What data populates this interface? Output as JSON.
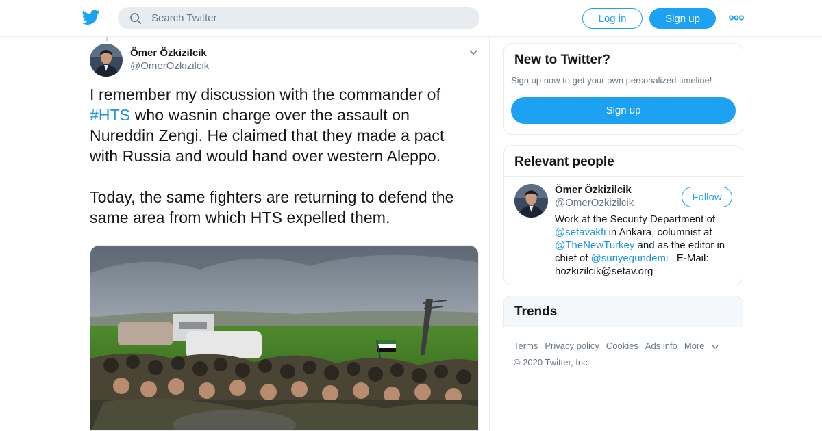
{
  "header": {
    "search_placeholder": "Search Twitter",
    "login_label": "Log in",
    "signup_label": "Sign up",
    "logo_icon": "twitter-bird-icon",
    "brand_color": "#1da1f2"
  },
  "tweet": {
    "author_name": "Ömer Özkizilcik",
    "author_handle": "@OmerOzkizilcik",
    "text_line1_a": "I remember my discussion with the commander of",
    "hashtag": "#HTS",
    "text_line2_b": " who wasnin charge over the assault on",
    "text_line3": "Nureddin Zengi. He claimed that they made a pact",
    "text_line4": "with Russia and would hand over western Aleppo.",
    "text_line5": "Today, the same fighters are returning to defend the",
    "text_line6": "same area from which HTS expelled them.",
    "hashtag_color": "#1b95e0"
  },
  "sidebar": {
    "new_title": "New to Twitter?",
    "new_sub": "Sign up now to get your own personalized timeline!",
    "new_signup_label": "Sign up",
    "relevant_title": "Relevant people",
    "person": {
      "name": "Ömer Özkizilcik",
      "handle": "@OmerOzkizilcik",
      "follow_label": "Follow",
      "bio_1": "Work at the Security Department of ",
      "mention_1": "@setavakfi",
      "bio_2": " in Ankara, columnist at ",
      "mention_2": "@TheNewTurkey",
      "bio_3": " and as the editor in chief of ",
      "mention_3": "@suriyegundemi_",
      "bio_4": " E-Mail: hozkizilcik@setav.org"
    },
    "trends_title": "Trends",
    "footer": {
      "terms": "Terms",
      "privacy": "Privacy policy",
      "cookies": "Cookies",
      "ads": "Ads info",
      "more": "More",
      "copyright": "© 2020 Twitter, Inc."
    }
  }
}
